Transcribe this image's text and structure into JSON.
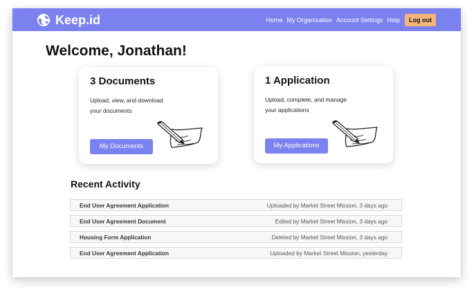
{
  "navbar": {
    "brand": "Keep.id",
    "links": [
      "Home",
      "My Organization",
      "Account Settings",
      "Help"
    ],
    "logout_label": "Log out",
    "color": "#7b82f0",
    "logout_color": "#f6b67a"
  },
  "welcome": "Welcome, Jonathan!",
  "cards": [
    {
      "title": "3 Documents",
      "description": "Upload, view, and download your documents",
      "button": "My Documents",
      "icon": "pen-writing-icon"
    },
    {
      "title": "1 Application",
      "description": "Upload, complete, and manage your applications",
      "button": "My Applications",
      "icon": "pen-writing-icon"
    }
  ],
  "recent_activity": {
    "heading": "Recent Activity",
    "items": [
      {
        "name": "End User Agreement Application",
        "detail": "Uploaded by Market Street Mission, 3 days ago"
      },
      {
        "name": "End User Agreement Document",
        "detail": "Edited by Market Street Mission, 3 days ago"
      },
      {
        "name": "Housing Form Application",
        "detail": "Deleted by Market Street Mission, 3 days ago"
      },
      {
        "name": "End User Agreement Application",
        "detail": "Uploaded by Market Street Mission, yesterday"
      }
    ]
  }
}
